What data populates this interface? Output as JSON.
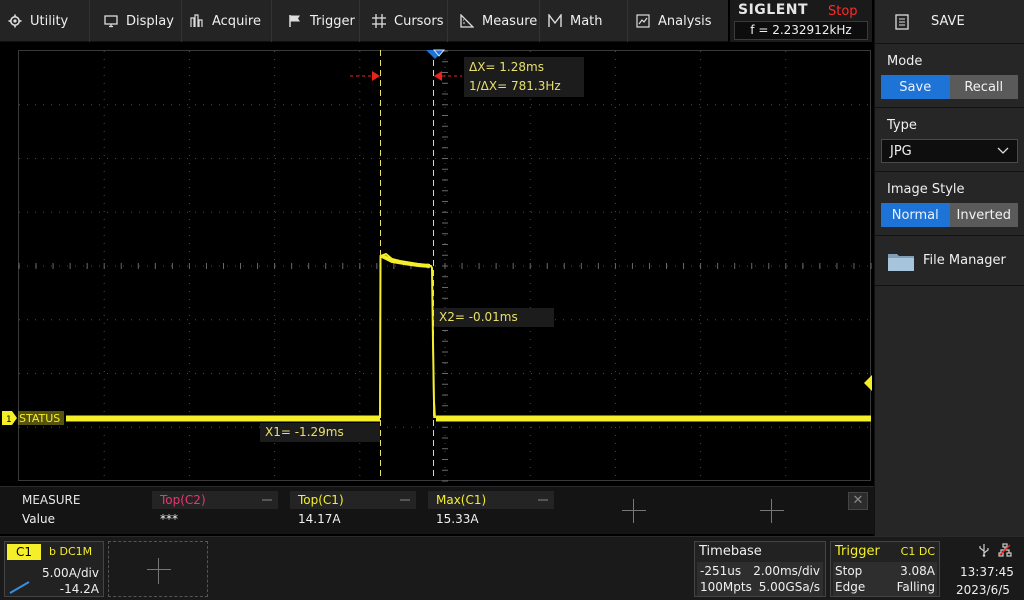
{
  "menu": [
    {
      "label": "Utility",
      "icon": "gear-icon"
    },
    {
      "label": "Display",
      "icon": "monitor-icon"
    },
    {
      "label": "Acquire",
      "icon": "acquire-icon"
    },
    {
      "label": "Trigger",
      "icon": "flag-icon"
    },
    {
      "label": "Cursors",
      "icon": "cursors-icon"
    },
    {
      "label": "Measure",
      "icon": "measure-icon"
    },
    {
      "label": "Math",
      "icon": "math-icon"
    },
    {
      "label": "Analysis",
      "icon": "analysis-icon"
    }
  ],
  "brand": {
    "logo": "SIGLENT",
    "run_state": "Stop",
    "frequency": "f = 2.232912kHz"
  },
  "right_panel": {
    "title": "SAVE",
    "mode": {
      "label": "Mode",
      "options": [
        "Save",
        "Recall"
      ],
      "selected": "Save"
    },
    "type": {
      "label": "Type",
      "value": "JPG"
    },
    "image_style": {
      "label": "Image Style",
      "options": [
        "Normal",
        "Inverted"
      ],
      "selected": "Normal"
    },
    "file_manager": "File Manager"
  },
  "screen": {
    "channel_label": "STATUS",
    "channel_marker": "1",
    "cursors": {
      "delta_x": "ΔX= 1.28ms",
      "inv_delta_x": "1/ΔX= 781.3Hz",
      "x1": "X1= -1.29ms",
      "x2": "X2= -0.01ms"
    }
  },
  "measure": {
    "title": "MEASURE",
    "row_label": "Value",
    "columns": [
      {
        "header": "Top(C2)",
        "value": "***",
        "color": "#e8366f"
      },
      {
        "header": "Top(C1)",
        "value": "14.17A",
        "color": "#f5ef2a"
      },
      {
        "header": "Max(C1)",
        "value": "15.33A",
        "color": "#f5ef2a"
      }
    ],
    "close": "✕"
  },
  "channel": {
    "tag": "C1",
    "coupling": "b DC1M",
    "scale": "5.00A/div",
    "offset": "-14.2A"
  },
  "timebase": {
    "label": "Timebase",
    "delay": "-251us",
    "scale": "2.00ms/div",
    "memory": "100Mpts",
    "sample_rate": "5.00GSa/s"
  },
  "trigger": {
    "label": "Trigger",
    "source": "C1 DC",
    "state": "Stop",
    "level": "3.08A",
    "type": "Edge",
    "slope": "Falling"
  },
  "clock": {
    "time": "13:37:45",
    "date": "2023/6/5"
  },
  "colors": {
    "ch1": "#f5ef2a",
    "accent": "#1e73d6",
    "stop": "#ff2a2a",
    "cursor_arrow": "#e8241e"
  }
}
